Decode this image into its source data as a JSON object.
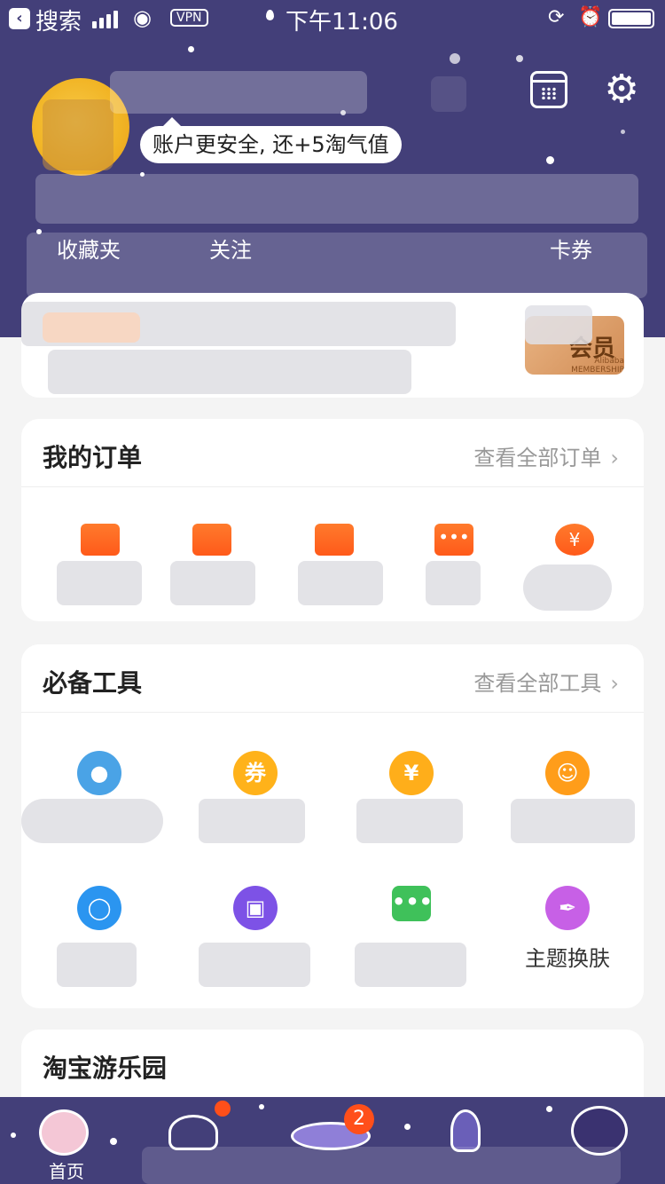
{
  "status_bar": {
    "back_app_label": "搜索",
    "vpn_label": "VPN",
    "time": "下午11:06"
  },
  "profile": {
    "security_tip": "账户更安全, 还+5淘气值",
    "fav_label": "收藏夹",
    "extra_labels": [
      "关注",
      "卡券"
    ]
  },
  "vip": {
    "badge_text": "会员",
    "badge_sub": "Alibaba MEMBERSHIP"
  },
  "orders": {
    "title": "我的订单",
    "view_all": "查看全部订单",
    "items": [
      {
        "icon": "wallet-icon"
      },
      {
        "icon": "package-icon"
      },
      {
        "icon": "delivery-truck-icon"
      },
      {
        "icon": "comment-icon"
      },
      {
        "icon": "refund-icon"
      }
    ]
  },
  "tools": {
    "title": "必备工具",
    "view_all": "查看全部工具",
    "items": [
      {
        "icon": "polar-bear-icon",
        "label": "",
        "color": "#4aa3e6"
      },
      {
        "icon": "coupon-icon",
        "label": "",
        "color": "#ffb21a"
      },
      {
        "icon": "yuan-coin-icon",
        "label": "",
        "color": "#ffae1a"
      },
      {
        "icon": "mascot-icon",
        "label": "",
        "color": "#ff9d1a"
      },
      {
        "icon": "drop-icon",
        "label": "",
        "color": "#2b95f0"
      },
      {
        "icon": "tv-icon",
        "label": "",
        "color": "#7d52e6"
      },
      {
        "icon": "chat-bubble-icon",
        "label": "",
        "color": "#3fc15a"
      },
      {
        "icon": "paint-brush-icon",
        "label": "主题换肤",
        "color": "#c760e6"
      }
    ]
  },
  "park": {
    "title": "淘宝游乐园"
  },
  "tabbar": {
    "home_label": "首页",
    "ufo_badge": "2"
  },
  "colors": {
    "header_bg": "#433f79",
    "accent": "#ff5a1a"
  }
}
